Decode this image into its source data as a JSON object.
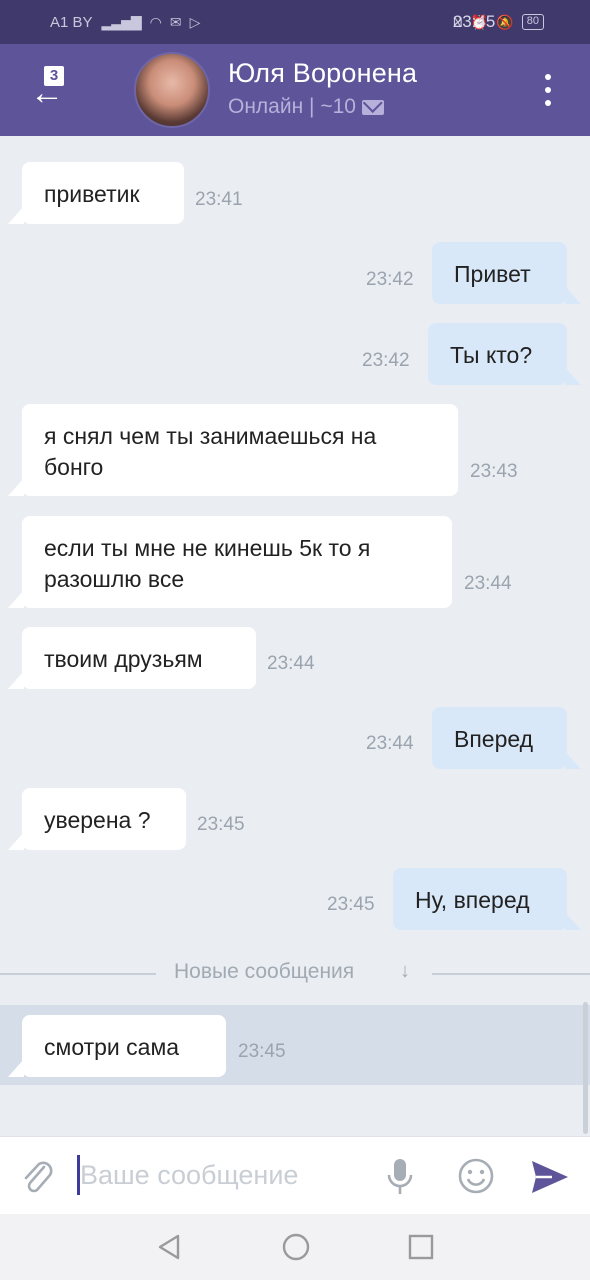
{
  "status_bar": {
    "carrier": "A1 BY",
    "battery": "80",
    "time": "23:45"
  },
  "header": {
    "back_badge": "3",
    "contact_name": "Юля Воронена",
    "contact_status": "Онлайн | ~10",
    "colors": {
      "bar": "#5e5499",
      "status_bar": "#3f3a6b"
    }
  },
  "messages": [
    {
      "direction": "in",
      "text": "приветик",
      "time": "23:41"
    },
    {
      "direction": "out",
      "text": "Привет",
      "time": "23:42"
    },
    {
      "direction": "out",
      "text": "Ты кто?",
      "time": "23:42"
    },
    {
      "direction": "in",
      "text": "я снял чем ты занимаешься на бонго",
      "time": "23:43"
    },
    {
      "direction": "in",
      "text": "если ты мне не кинешь 5к то я разошлю все",
      "time": "23:44"
    },
    {
      "direction": "in",
      "text": "твоим друзьям",
      "time": "23:44"
    },
    {
      "direction": "out",
      "text": "Вперед",
      "time": "23:44"
    },
    {
      "direction": "in",
      "text": "уверена ?",
      "time": "23:45"
    },
    {
      "direction": "out",
      "text": "Ну, вперед",
      "time": "23:45"
    },
    {
      "direction": "in",
      "text": "смотри сама",
      "time": "23:45"
    }
  ],
  "new_messages_divider": {
    "label": "Новые сообщения",
    "arrow": "↓"
  },
  "composer": {
    "placeholder": "Ваше сообщение",
    "icons": [
      "paperclip-icon",
      "microphone-icon",
      "emoji-icon",
      "send-icon"
    ]
  },
  "navigation": {
    "icons": [
      "back-triangle-icon",
      "home-circle-icon",
      "recent-square-icon"
    ]
  }
}
